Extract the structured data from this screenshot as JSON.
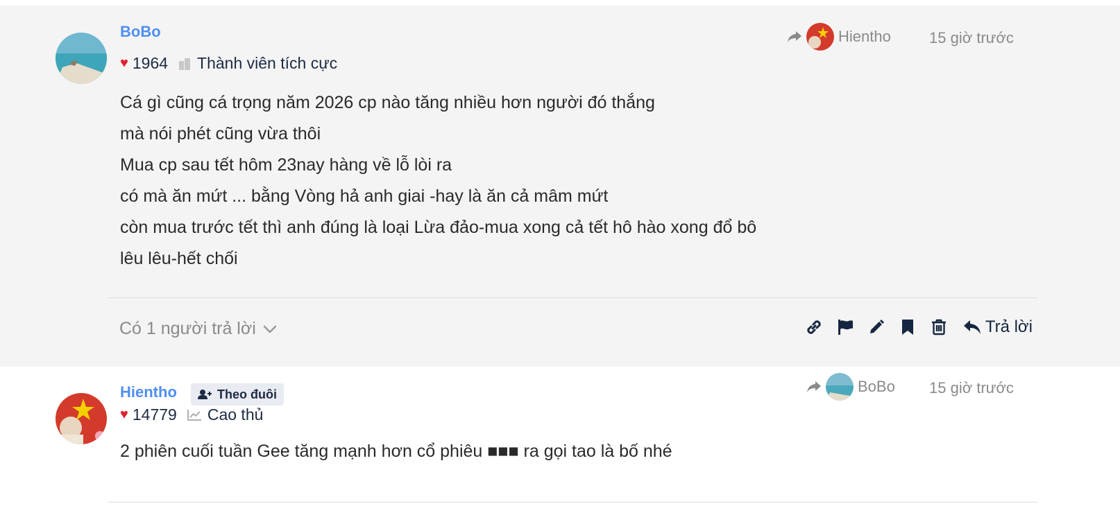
{
  "posts": [
    {
      "author": "BoBo",
      "likes": "1964",
      "rank": "Thành viên tích cực",
      "reply_to": "Hientho",
      "time": "15 giờ trước",
      "lines": [
        "Cá gì cũng cá trọng năm 2026 cp nào tăng nhiều hơn người đó thắng",
        "mà nói phét cũng vừa thôi",
        "Mua cp sau tết hôm 23nay hàng về lỗ lòi ra",
        "có mà ăn mứt ... bằng Vòng hả anh giai -hay là ăn cả mâm mứt",
        "còn mua trước tết thì anh đúng là loại Lừa đảo-mua xong cả tết hô hào xong đổ bô",
        "lêu lêu-hết chối"
      ],
      "replies_count": "Có 1 người trả lời",
      "reply_label": "Trả lời"
    },
    {
      "author": "Hientho",
      "follow_label": "Theo đuôi",
      "likes": "14779",
      "rank": "Cao thủ",
      "reply_to": "BoBo",
      "time": "15 giờ trước",
      "lines": [
        "2 phiên cuối tuần Gee tăng mạnh hơn cổ phiêu ■■■ ra gọi tao là bố nhé"
      ]
    }
  ],
  "icons": {
    "heart": "heart-icon",
    "rank_1": "building-icon",
    "rank_2": "chart-line-icon",
    "share": "share-arrow-icon",
    "actions": [
      "link-icon",
      "flag-icon",
      "pencil-icon",
      "bookmark-icon",
      "trash-icon",
      "reply-icon"
    ],
    "chevron": "chevron-down-icon",
    "follow": "user-plus-icon"
  },
  "colors": {
    "username": "#4f8ff0",
    "heart": "#e0202e",
    "muted": "#8a8a8a",
    "dark": "#152640",
    "post_bg": "#f4f4f4"
  }
}
